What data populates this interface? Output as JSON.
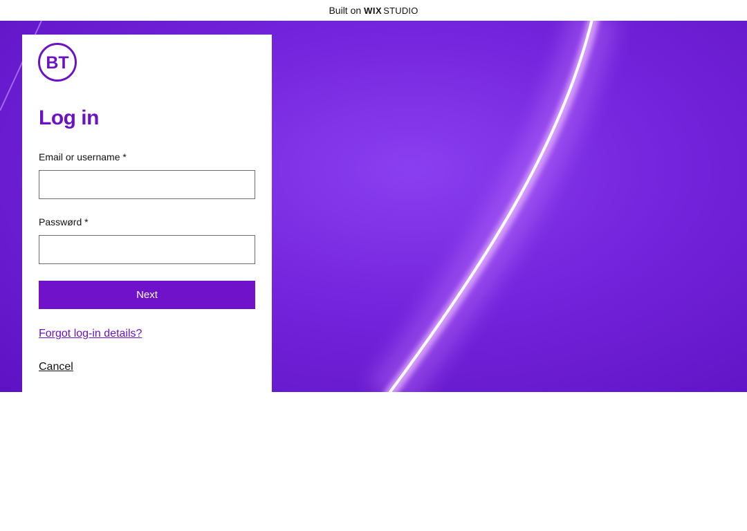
{
  "banner": {
    "built_on": "Built on",
    "wix": "WIX",
    "studio": "STUDIO"
  },
  "logo": {
    "text": "BT",
    "color": "#6a12c4"
  },
  "login": {
    "title": "Log in",
    "email_label": "Email or username *",
    "email_value": "",
    "password_label": "Passwørd *",
    "password_value": "",
    "next_label": "Next",
    "forgot_label": "Forgot log-in details?",
    "cancel_label": "Cancel"
  },
  "colors": {
    "accent": "#7112cb",
    "title": "#6a12c4",
    "hero_base": "#7424dc"
  }
}
